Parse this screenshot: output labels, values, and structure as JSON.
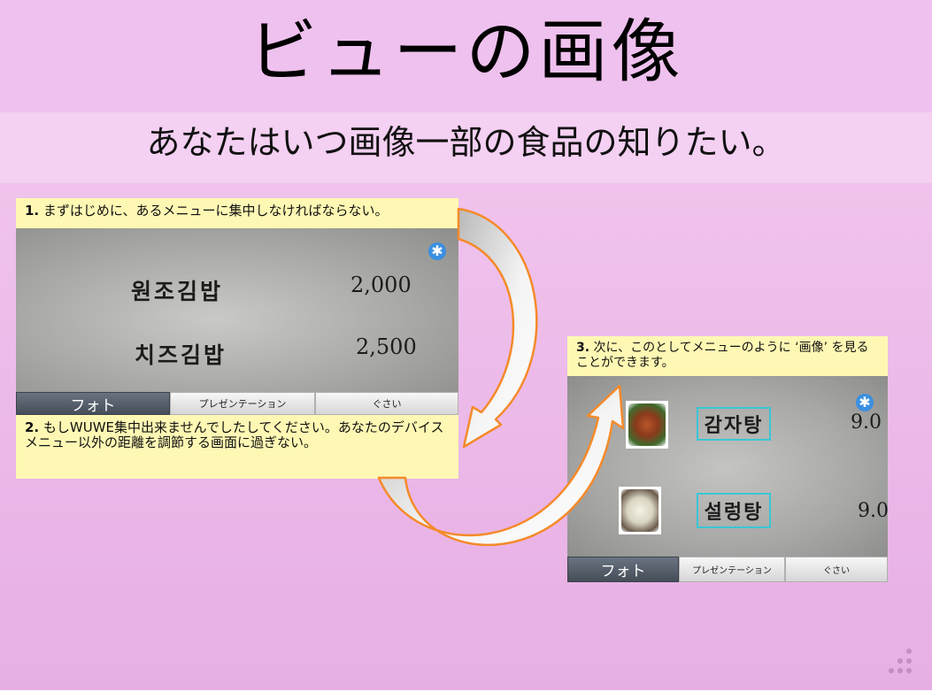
{
  "slide": {
    "title": "ビューの画像",
    "subtitle": "あなたはいつ画像一部の食品の知りたい。"
  },
  "steps": [
    {
      "number": "1.",
      "text": " まずはじめに、あるメニューに集中しなければならない。"
    },
    {
      "number": "2.",
      "text": " もしWUWE集中出来ませんでしたしてください。あなたのデバイスメニュー以外の距離を調節する画面に過ぎない。"
    },
    {
      "number": "3.",
      "text": " 次に、このとしてメニューのように ‘画像’ を見ることができます。"
    }
  ],
  "screen1": {
    "items": [
      {
        "name": "원조김밥",
        "price": "2,000"
      },
      {
        "name": "치즈김밥",
        "price": "2,500"
      }
    ],
    "tabs": [
      "フォト",
      "プレゼンテーション",
      "ぐさい"
    ]
  },
  "screen2": {
    "items": [
      {
        "name": "감자탕",
        "price": "9.0"
      },
      {
        "name": "설렁탕",
        "price": "9.0"
      }
    ],
    "tabs": [
      "フォト",
      "プレゼンテーション",
      "ぐさい"
    ]
  },
  "icons": {
    "settings": "gear-icon",
    "curved_arrow": "curved-arrow-icon"
  },
  "colors": {
    "caption_bg": "#fff8b4",
    "arrow_outline": "#f58a2a",
    "label_box": "#38c7d4",
    "active_tab": "#4f5763"
  }
}
